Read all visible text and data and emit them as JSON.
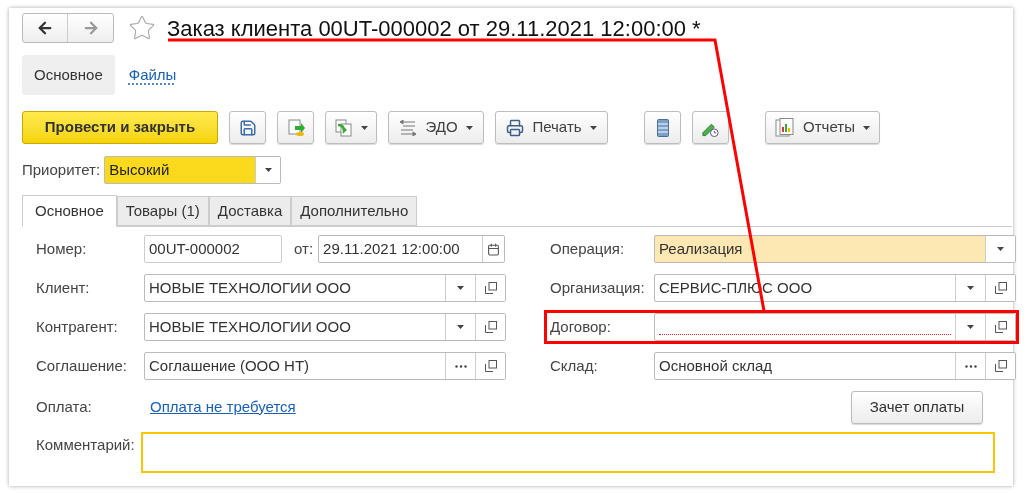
{
  "title": "Заказ клиента 00UT-000002 от 29.11.2021 12:00:00 *",
  "sections": [
    {
      "label": "Основное",
      "selected": true
    },
    {
      "label": "Файлы",
      "selected": false
    }
  ],
  "toolbar": {
    "primary": "Провести и закрыть",
    "edo": "ЭДО",
    "print": "Печать",
    "reports": "Отчеты"
  },
  "priority": {
    "label": "Приоритет:",
    "value": "Высокий"
  },
  "tabs": [
    {
      "label": "Основное",
      "selected": true
    },
    {
      "label": "Товары (1)",
      "selected": false
    },
    {
      "label": "Доставка",
      "selected": false
    },
    {
      "label": "Дополнительно",
      "selected": false
    }
  ],
  "left_fields": [
    {
      "label": "Номер:",
      "kind": "number",
      "value": "00UT-000002",
      "date_label": "от:",
      "date_value": "29.11.2021 12:00:00"
    },
    {
      "label": "Клиент:",
      "kind": "select",
      "value": "НОВЫЕ ТЕХНОЛОГИИ ООО"
    },
    {
      "label": "Контрагент:",
      "kind": "select",
      "value": "НОВЫЕ ТЕХНОЛОГИИ ООО"
    },
    {
      "label": "Соглашение:",
      "kind": "choice",
      "value": "Соглашение (ООО НТ)"
    }
  ],
  "right_fields": [
    {
      "label": "Операция:",
      "kind": "enum",
      "value": "Реализация",
      "highlighted": true
    },
    {
      "label": "Организация:",
      "kind": "select",
      "value": "СЕРВИС-ПЛЮС ООО",
      "highlighted": false
    },
    {
      "label": "Договор:",
      "kind": "select",
      "required_empty": true,
      "marked": true,
      "highlighted": false
    },
    {
      "label": "Склад:",
      "kind": "choice",
      "value": "Основной склад",
      "highlighted": false
    }
  ],
  "payment": {
    "label": "Оплата:",
    "link": "Оплата не требуется"
  },
  "offset_button": "Зачет оплаты",
  "comment": {
    "label": "Комментарий:",
    "focused": true
  }
}
